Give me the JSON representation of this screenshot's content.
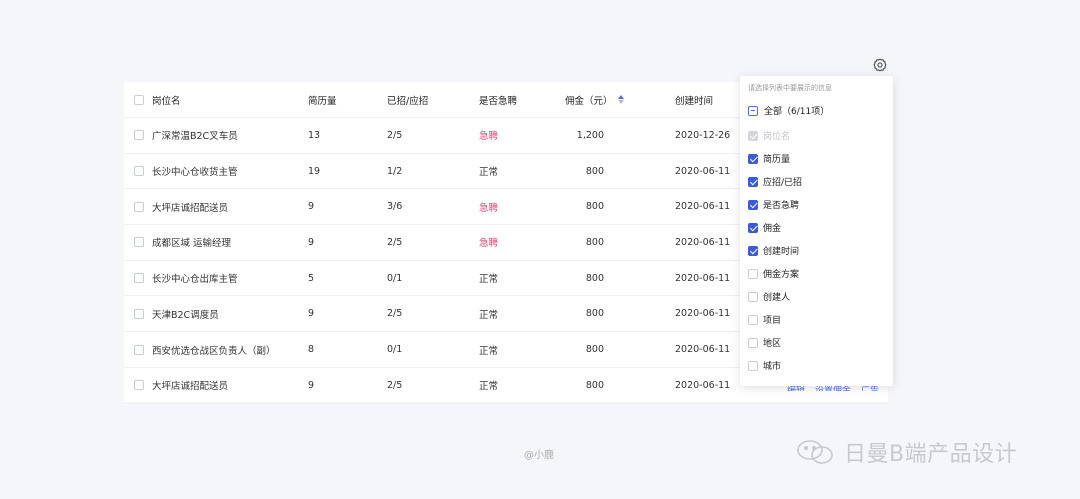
{
  "table": {
    "headers": {
      "name": "岗位名",
      "resume": "简历量",
      "ratio": "已招/应招",
      "urgent": "是否急聘",
      "fee": "佣金（元）",
      "date": "创建时间"
    },
    "rows": [
      {
        "name": "广深常温B2C叉车员",
        "resume": "13",
        "ratio": "2/5",
        "urgent": "急聘",
        "fee": "1,200",
        "date": "2020-12-26"
      },
      {
        "name": "长沙中心仓收货主管",
        "resume": "19",
        "ratio": "1/2",
        "urgent": "正常",
        "fee": "800",
        "date": "2020-06-11"
      },
      {
        "name": "大坪店诚招配送员",
        "resume": "9",
        "ratio": "3/6",
        "urgent": "急聘",
        "fee": "800",
        "date": "2020-06-11"
      },
      {
        "name": "成都区域 运输经理",
        "resume": "9",
        "ratio": "2/5",
        "urgent": "急聘",
        "fee": "800",
        "date": "2020-06-11"
      },
      {
        "name": "长沙中心仓出库主管",
        "resume": "5",
        "ratio": "0/1",
        "urgent": "正常",
        "fee": "800",
        "date": "2020-06-11"
      },
      {
        "name": "天津B2C调度员",
        "resume": "9",
        "ratio": "2/5",
        "urgent": "正常",
        "fee": "800",
        "date": "2020-06-11"
      },
      {
        "name": "西安优选仓战区负责人（副）",
        "resume": "8",
        "ratio": "0/1",
        "urgent": "正常",
        "fee": "800",
        "date": "2020-06-11"
      },
      {
        "name": "大坪店诚招配送员",
        "resume": "9",
        "ratio": "2/5",
        "urgent": "正常",
        "fee": "800",
        "date": "2020-06-11"
      }
    ],
    "ops": [
      "编辑",
      "设置佣金",
      "广告"
    ]
  },
  "column_panel": {
    "hint": "请选择列表中要展示的信息",
    "all_label": "全部（6/11项）",
    "options": [
      {
        "label": "岗位名",
        "state": "disabled"
      },
      {
        "label": "简历量",
        "state": "checked"
      },
      {
        "label": "应招/已招",
        "state": "checked"
      },
      {
        "label": "是否急聘",
        "state": "checked"
      },
      {
        "label": "佣金",
        "state": "checked"
      },
      {
        "label": "创建时间",
        "state": "checked"
      },
      {
        "label": "佣金方案",
        "state": "unchecked"
      },
      {
        "label": "创建人",
        "state": "unchecked"
      },
      {
        "label": "项目",
        "state": "unchecked"
      },
      {
        "label": "地区",
        "state": "unchecked"
      },
      {
        "label": "城市",
        "state": "unchecked"
      }
    ]
  },
  "watermark": {
    "small": "@小鹿",
    "big": "日曼B端产品设计"
  },
  "colors": {
    "accent": "#3b5bdb",
    "urgent": "#e6436d",
    "background": "#f5f6fa"
  },
  "icons": [
    "gear-icon",
    "sort-icon",
    "wechat-icon"
  ]
}
